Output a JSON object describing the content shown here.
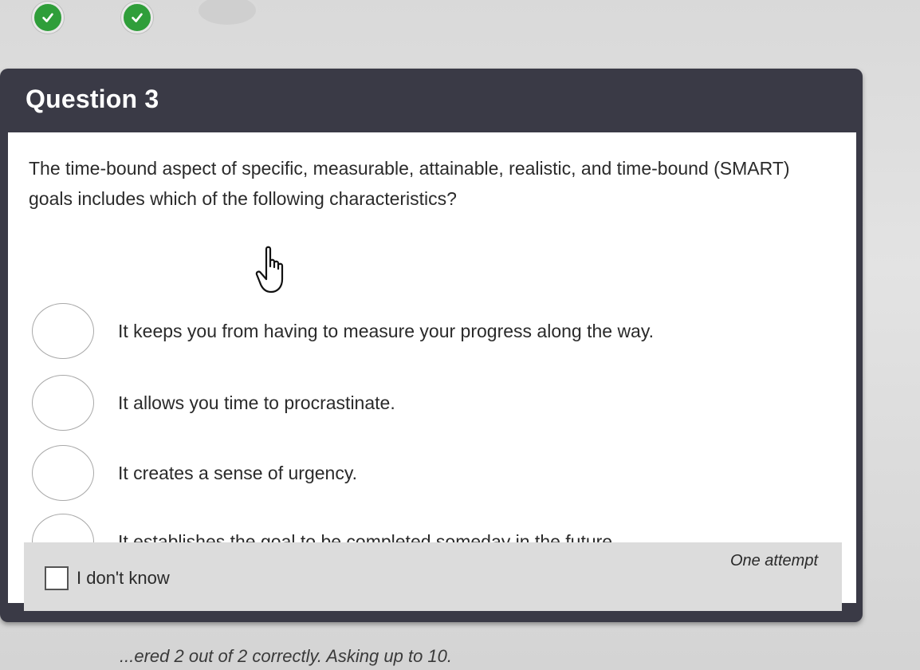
{
  "progress": {
    "items": [
      {
        "state": "correct",
        "icon": "check-icon"
      },
      {
        "state": "correct",
        "icon": "check-icon"
      },
      {
        "state": "pending"
      }
    ]
  },
  "question": {
    "title": "Question 3",
    "text": "The time-bound aspect of specific, measurable, attainable, realistic, and time-bound (SMART) goals includes which of the following characteristics?",
    "options": [
      {
        "label": "It keeps you from having to measure your progress along the way."
      },
      {
        "label": "It allows you time to procrastinate."
      },
      {
        "label": "It creates a sense of urgency."
      },
      {
        "label": "It establishes the goal to be completed someday in the future."
      }
    ]
  },
  "footer": {
    "dont_know_label": "I don't know",
    "attempt_label": "One attempt"
  },
  "status": {
    "text": "...ered 2 out of 2 correctly. Asking up to 10."
  },
  "colors": {
    "header_bg": "#3a3a46",
    "correct": "#2f9e3a",
    "card_body": "#ffffff"
  }
}
